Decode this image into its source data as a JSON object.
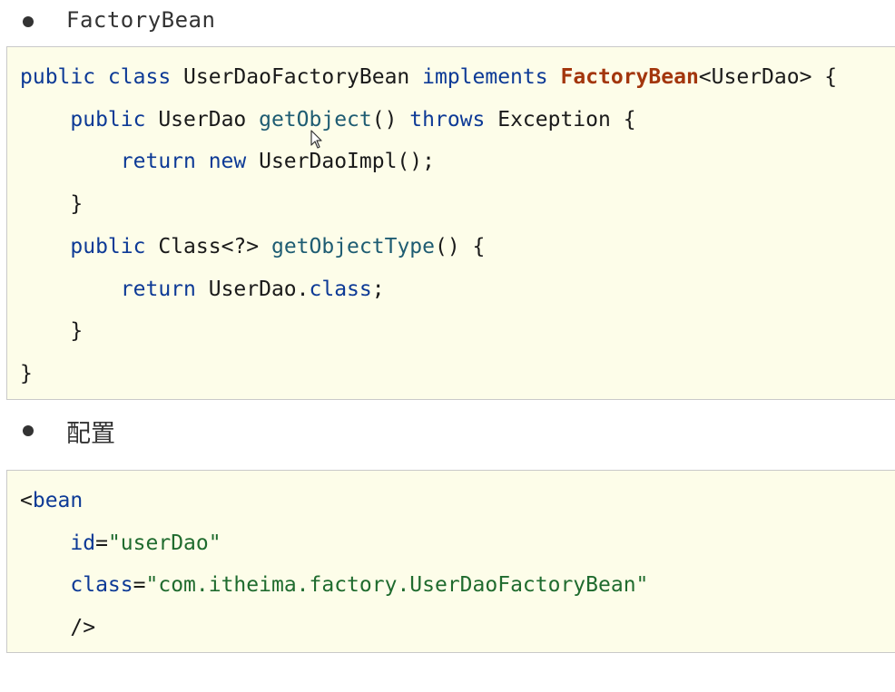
{
  "section1": {
    "heading": "FactoryBean",
    "code_lines": [
      [
        {
          "t": "public class",
          "c": "kw"
        },
        {
          "t": " UserDaoFactoryBean ",
          "c": "tx"
        },
        {
          "t": "implements",
          "c": "kw"
        },
        {
          "t": " ",
          "c": "tx"
        },
        {
          "t": "FactoryBean",
          "c": "hl"
        },
        {
          "t": "<UserDao> {",
          "c": "tx"
        }
      ],
      [
        {
          "t": "    ",
          "c": "tx"
        },
        {
          "t": "public",
          "c": "kw"
        },
        {
          "t": " UserDao ",
          "c": "tx"
        },
        {
          "t": "getObject",
          "c": "fn"
        },
        {
          "t": "() ",
          "c": "tx"
        },
        {
          "t": "throws",
          "c": "kw"
        },
        {
          "t": " Exception {",
          "c": "tx"
        }
      ],
      [
        {
          "t": "        ",
          "c": "tx"
        },
        {
          "t": "return new",
          "c": "kw"
        },
        {
          "t": " UserDaoImpl();",
          "c": "tx"
        }
      ],
      [
        {
          "t": "    }",
          "c": "tx"
        }
      ],
      [
        {
          "t": "    ",
          "c": "tx"
        },
        {
          "t": "public",
          "c": "kw"
        },
        {
          "t": " Class<?> ",
          "c": "tx"
        },
        {
          "t": "getObjectType",
          "c": "fn"
        },
        {
          "t": "() {",
          "c": "tx"
        }
      ],
      [
        {
          "t": "        ",
          "c": "tx"
        },
        {
          "t": "return",
          "c": "kw"
        },
        {
          "t": " UserDao.",
          "c": "tx"
        },
        {
          "t": "class",
          "c": "kw"
        },
        {
          "t": ";",
          "c": "tx"
        }
      ],
      [
        {
          "t": "    }",
          "c": "tx"
        }
      ],
      [
        {
          "t": "}",
          "c": "tx"
        }
      ]
    ]
  },
  "section2": {
    "heading": "配置",
    "code_lines": [
      [
        {
          "t": "<",
          "c": "tx"
        },
        {
          "t": "bean",
          "c": "xtag"
        }
      ],
      [
        {
          "t": "    ",
          "c": "tx"
        },
        {
          "t": "id",
          "c": "xattr"
        },
        {
          "t": "=",
          "c": "tx"
        },
        {
          "t": "\"userDao\"",
          "c": "xval"
        }
      ],
      [
        {
          "t": "    ",
          "c": "tx"
        },
        {
          "t": "class",
          "c": "xattr"
        },
        {
          "t": "=",
          "c": "tx"
        },
        {
          "t": "\"com.itheima.factory.UserDaoFactoryBean\"",
          "c": "xval"
        }
      ],
      [
        {
          "t": "    />",
          "c": "tx"
        }
      ]
    ]
  },
  "icons": {
    "cursor": "mouse-pointer-icon",
    "bullet": "bullet-dot-icon"
  },
  "colors": {
    "code_background": "#fdfde9",
    "keyword": "#0d3a96",
    "method": "#1e5c72",
    "highlight": "#a3360d",
    "xml_value": "#1f6b2e",
    "text": "#1a1a1a"
  }
}
